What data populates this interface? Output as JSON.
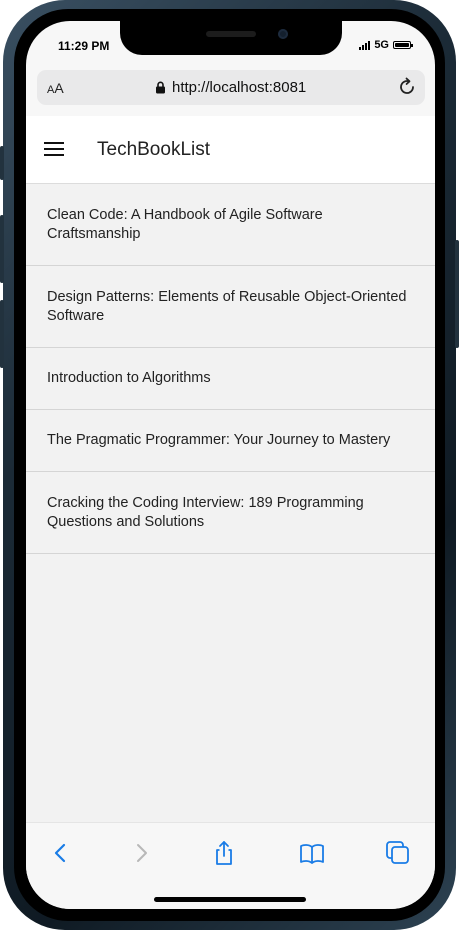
{
  "status_bar": {
    "time": "11:29 PM",
    "network": "5G"
  },
  "browser": {
    "text_size_small": "A",
    "text_size_large": "A",
    "url": "http://localhost:8081"
  },
  "app": {
    "title": "TechBookList",
    "books": [
      "Clean Code: A Handbook of Agile Software Craftsmanship",
      "Design Patterns: Elements of Reusable Object-Oriented Software",
      "Introduction to Algorithms",
      "The Pragmatic Programmer: Your Journey to Mastery",
      "Cracking the Coding Interview: 189 Programming Questions and Solutions"
    ]
  },
  "toolbar": {
    "icons": [
      "back-icon",
      "forward-icon",
      "share-icon",
      "bookmarks-icon",
      "tabs-icon"
    ]
  },
  "colors": {
    "accent": "#1a7ce6",
    "disabled": "#b8b8b8",
    "list_background": "#f2f2f2",
    "header_background": "#ffffff"
  }
}
